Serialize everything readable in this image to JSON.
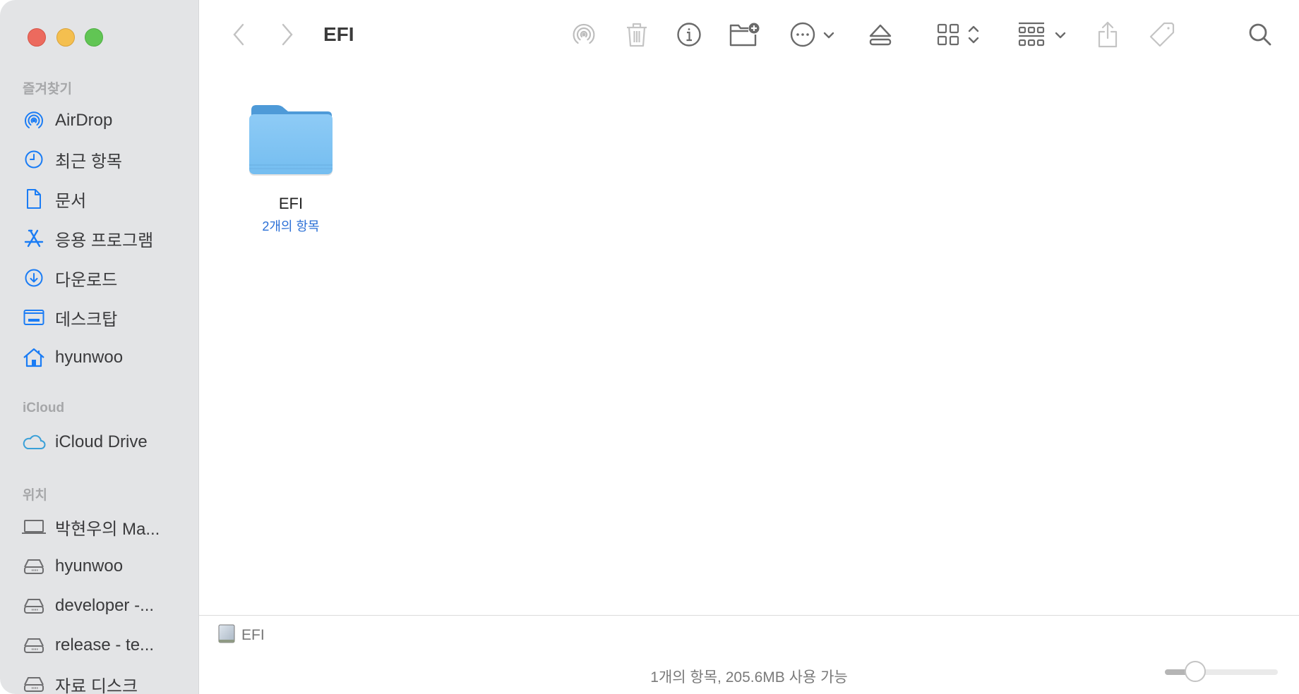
{
  "window": {
    "title": "EFI",
    "traffic_lights": [
      "close",
      "minimize",
      "zoom"
    ]
  },
  "sidebar": {
    "sections": [
      {
        "header": "즐겨찾기",
        "items": [
          {
            "label": "AirDrop",
            "icon": "airdrop-icon"
          },
          {
            "label": "최근 항목",
            "icon": "clock-icon"
          },
          {
            "label": "문서",
            "icon": "document-icon"
          },
          {
            "label": "응용 프로그램",
            "icon": "applications-icon"
          },
          {
            "label": "다운로드",
            "icon": "download-icon"
          },
          {
            "label": "데스크탑",
            "icon": "desktop-icon"
          },
          {
            "label": "hyunwoo",
            "icon": "home-icon"
          }
        ]
      },
      {
        "header": "iCloud",
        "items": [
          {
            "label": "iCloud Drive",
            "icon": "cloud-icon"
          }
        ]
      },
      {
        "header": "위치",
        "items": [
          {
            "label": "박현우의 Ma...",
            "icon": "laptop-icon"
          },
          {
            "label": "hyunwoo",
            "icon": "drive-icon"
          },
          {
            "label": "developer -...",
            "icon": "drive-icon"
          },
          {
            "label": "release - te...",
            "icon": "drive-icon"
          },
          {
            "label": "자료 디스크",
            "icon": "drive-icon"
          }
        ]
      }
    ]
  },
  "toolbar": {
    "title": "EFI",
    "buttons": [
      "back",
      "forward",
      "airdrop",
      "delete",
      "get-info",
      "new-folder",
      "more-actions",
      "eject",
      "view-mode",
      "group-by",
      "share",
      "tags",
      "search"
    ]
  },
  "content": {
    "items": [
      {
        "name": "EFI",
        "subtitle": "2개의 항목",
        "type": "folder"
      }
    ]
  },
  "pathbar": {
    "items": [
      {
        "label": "EFI",
        "icon": "disk-icon"
      }
    ]
  },
  "statusbar": {
    "text": "1개의 항목, 205.6MB 사용 가능",
    "icon_size_slider_fraction": 0.27
  },
  "colors": {
    "accent": "#1a7cf5",
    "sidebar_bg": "#e3e4e6",
    "folder": "#7ec3f2",
    "subtitle": "#2a6fd6"
  }
}
